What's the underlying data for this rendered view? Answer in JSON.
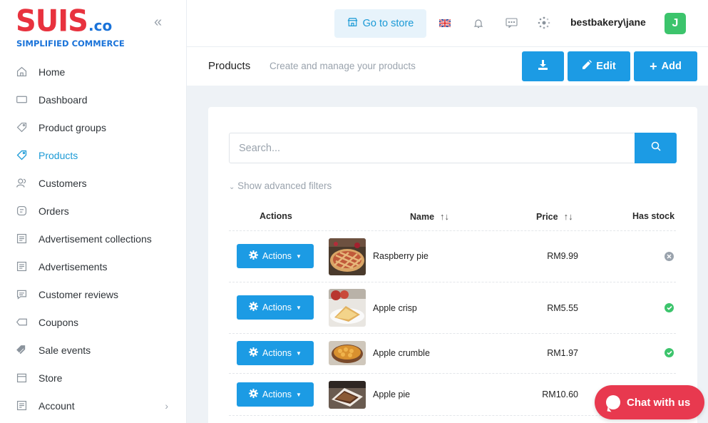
{
  "brand": {
    "logo_main": "SUIS",
    "logo_suffix": ".co",
    "logo_tagline": "SIMPLIFIED COMMERCE"
  },
  "sidebar": {
    "items": [
      {
        "label": "Home",
        "icon": "home-icon",
        "active": false
      },
      {
        "label": "Dashboard",
        "icon": "dashboard-icon",
        "active": false
      },
      {
        "label": "Product groups",
        "icon": "tag-icon",
        "active": false
      },
      {
        "label": "Products",
        "icon": "tag-icon",
        "active": true
      },
      {
        "label": "Customers",
        "icon": "users-icon",
        "active": false
      },
      {
        "label": "Orders",
        "icon": "orders-icon",
        "active": false
      },
      {
        "label": "Advertisement collections",
        "icon": "newspaper-icon",
        "active": false
      },
      {
        "label": "Advertisements",
        "icon": "newspaper-icon",
        "active": false
      },
      {
        "label": "Customer reviews",
        "icon": "comment-icon",
        "active": false
      },
      {
        "label": "Coupons",
        "icon": "coupon-icon",
        "active": false
      },
      {
        "label": "Sale events",
        "icon": "tags-icon",
        "active": false
      },
      {
        "label": "Store",
        "icon": "store-icon",
        "active": false
      },
      {
        "label": "Account",
        "icon": "account-icon",
        "active": false,
        "has_children": true
      }
    ]
  },
  "topbar": {
    "go_to_store": "Go to store",
    "user": "bestbakery\\jane",
    "avatar_initial": "J"
  },
  "page": {
    "title": "Products",
    "subtitle": "Create and manage your products",
    "edit_label": "Edit",
    "add_label": "Add"
  },
  "search": {
    "placeholder": "Search...",
    "advanced_filters": "Show advanced filters"
  },
  "table": {
    "headers": {
      "actions": "Actions",
      "name": "Name",
      "price": "Price",
      "stock": "Has stock"
    },
    "action_label": "Actions",
    "rows": [
      {
        "name": "Raspberry pie",
        "price": "RM9.99",
        "has_stock": false
      },
      {
        "name": "Apple crisp",
        "price": "RM5.55",
        "has_stock": true
      },
      {
        "name": "Apple crumble",
        "price": "RM1.97",
        "has_stock": true
      },
      {
        "name": "Apple pie",
        "price": "RM10.60",
        "has_stock": true
      }
    ]
  },
  "chat": {
    "label": "Chat with us"
  },
  "colors": {
    "accent": "#1c9be4",
    "active_nav": "#1b9ad6",
    "in_stock": "#3cc46c",
    "out_of_stock": "#9aa3ad",
    "chat": "#e8394f",
    "brand_red": "#e8323e",
    "brand_blue": "#1a73d9"
  }
}
